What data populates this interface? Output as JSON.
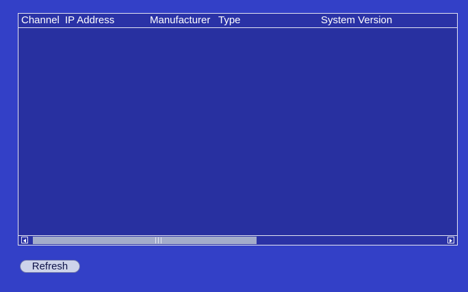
{
  "table": {
    "columns": {
      "channel": "Channel",
      "ip_address": "IP Address",
      "manufacturer": "Manufacturer",
      "type": "Type",
      "system_version": "System Version"
    },
    "rows": []
  },
  "scrollbar": {
    "position_fraction": 0.0
  },
  "actions": {
    "refresh_label": "Refresh"
  },
  "colors": {
    "background": "#3340c7",
    "panel": "#2830a0",
    "border": "#e6e6f2",
    "scroll_thumb": "#a3acca",
    "button": "#cdd3ea"
  }
}
